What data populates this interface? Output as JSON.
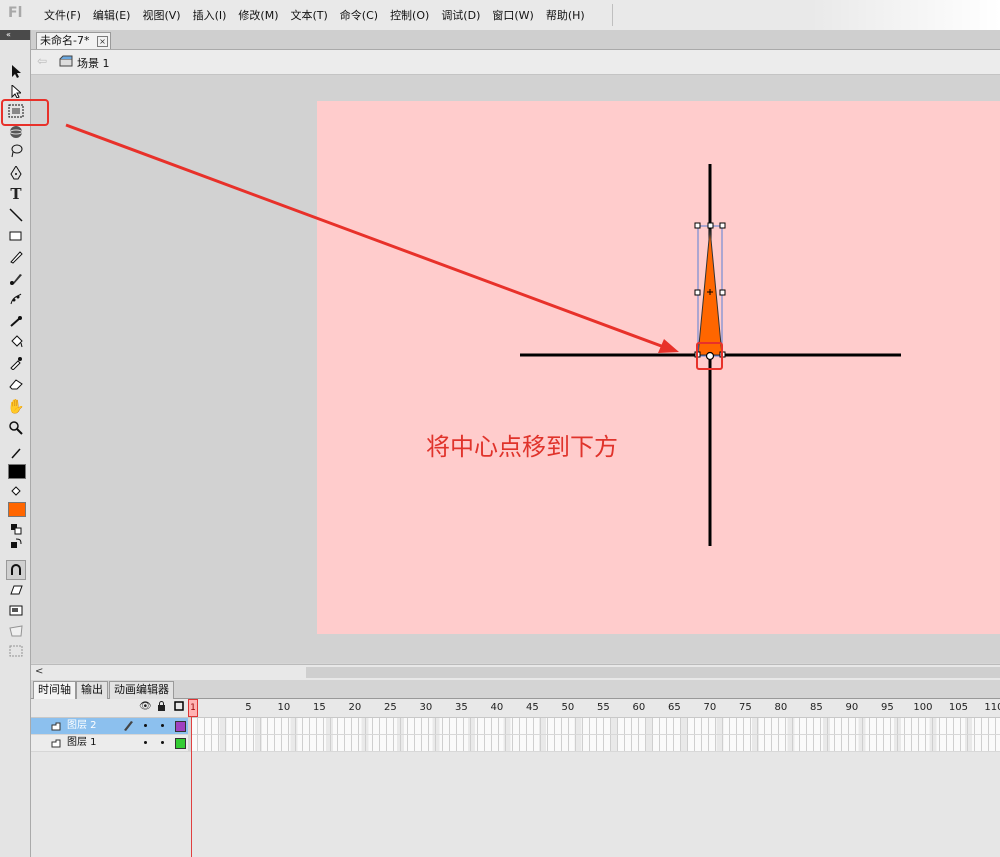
{
  "app": {
    "logo": "Fl"
  },
  "menu": [
    "文件(F)",
    "编辑(E)",
    "视图(V)",
    "插入(I)",
    "修改(M)",
    "文本(T)",
    "命令(C)",
    "控制(O)",
    "调试(D)",
    "窗口(W)",
    "帮助(H)"
  ],
  "toolbox": {
    "tools": [
      {
        "name": "selection-tool-icon"
      },
      {
        "name": "subselection-tool-icon"
      },
      {
        "name": "free-transform-tool-icon"
      },
      {
        "name": "3d-rotation-tool-icon"
      },
      {
        "name": "lasso-tool-icon"
      },
      {
        "name": "pen-tool-icon"
      },
      {
        "name": "text-tool-icon"
      },
      {
        "name": "line-tool-icon"
      },
      {
        "name": "rectangle-tool-icon"
      },
      {
        "name": "pencil-tool-icon"
      },
      {
        "name": "brush-tool-icon"
      },
      {
        "name": "deco-tool-icon"
      },
      {
        "name": "bone-tool-icon"
      },
      {
        "name": "paint-bucket-tool-icon"
      },
      {
        "name": "eyedropper-tool-icon"
      },
      {
        "name": "eraser-tool-icon"
      },
      {
        "name": "hand-tool-icon"
      },
      {
        "name": "zoom-tool-icon"
      }
    ],
    "stroke_color": "#000000",
    "fill_color": "#ff6600"
  },
  "document": {
    "tab_title": "未命名-7*",
    "close": "×"
  },
  "editbar": {
    "scene": "场景 1"
  },
  "stage": {
    "color": "#ffcccc",
    "caption": "将中心点移到下方",
    "shape_fill": "#ff6600",
    "annotation_color": "#e8312a"
  },
  "timeline": {
    "tabs": [
      "时间轴",
      "输出",
      "动画编辑器"
    ],
    "frame_numbers": [
      5,
      10,
      15,
      20,
      25,
      30,
      35,
      40,
      45,
      50,
      55,
      60,
      65,
      70,
      75,
      80,
      85,
      90,
      95,
      100,
      105,
      110
    ],
    "playhead": "1",
    "layers": [
      {
        "name": "图层 2",
        "color": "#a040c0",
        "selected": true
      },
      {
        "name": "图层 1",
        "color": "#33cc33",
        "selected": false
      }
    ]
  }
}
